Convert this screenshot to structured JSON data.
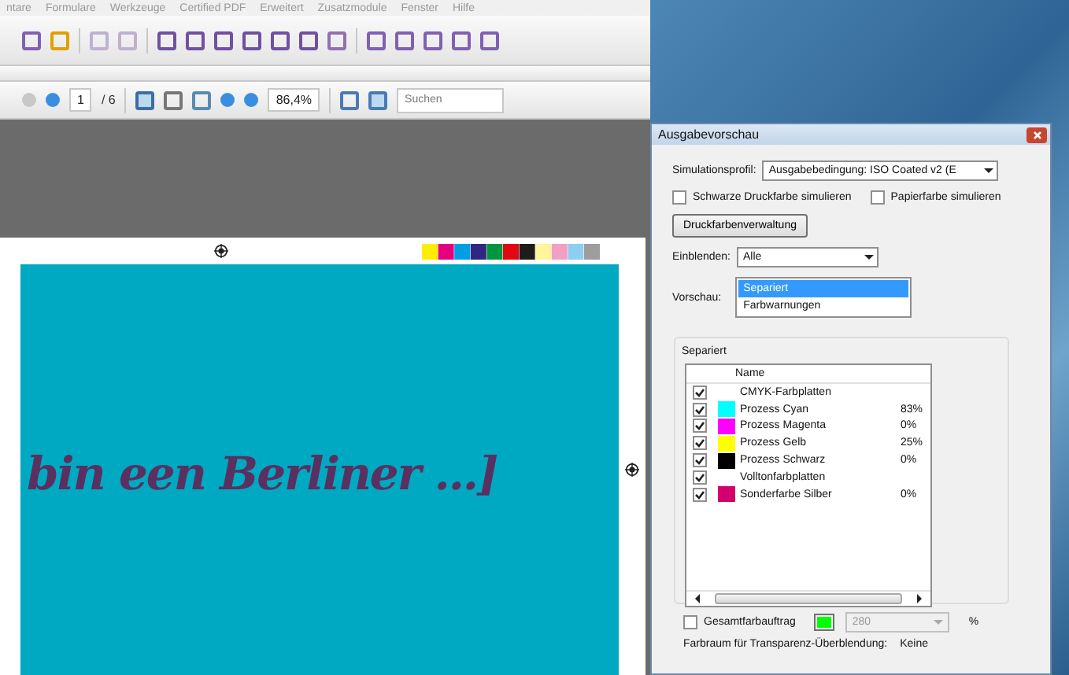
{
  "menu": [
    "ntare",
    "Formulare",
    "Werkzeuge",
    "Certified PDF",
    "Erweitert",
    "Zusatzmodule",
    "Fenster",
    "Hilfe"
  ],
  "navigation": {
    "page": "1",
    "page_count": "/ 6",
    "zoom": "86,4%",
    "search": {
      "placeholder": "Suchen"
    }
  },
  "document": {
    "headline": "bin een Berliner ...]"
  },
  "dialog": {
    "title": "Ausgabevorschau",
    "profile": {
      "label": "Simulationsprofil:",
      "value": "Ausgabebedingung: ISO Coated v2 (E"
    },
    "options": [
      {
        "label": "Schwarze Druckfarbe simulieren",
        "checked": false
      },
      {
        "label": "Papierfarbe simulieren",
        "checked": false
      }
    ],
    "ink_button": "Druckfarbenverwaltung",
    "show": {
      "label": "Einblenden:",
      "value": "Alle"
    },
    "preview": {
      "label": "Vorschau:",
      "items": [
        {
          "label": "Separiert",
          "selected": true
        },
        {
          "label": "Farbwarnungen",
          "selected": false
        }
      ]
    },
    "group_title": "Separiert",
    "column_name": "Name",
    "plates": [
      {
        "kind": "group",
        "name": "CMYK-Farbplatten",
        "checked": true
      },
      {
        "kind": "plate",
        "name": "Prozess Cyan",
        "checked": true,
        "color": "#00ffff",
        "value": "83%"
      },
      {
        "kind": "plate",
        "name": "Prozess Magenta",
        "checked": true,
        "color": "#ff00ff",
        "value": "0%"
      },
      {
        "kind": "plate",
        "name": "Prozess Gelb",
        "checked": true,
        "color": "#ffff00",
        "value": "25%"
      },
      {
        "kind": "plate",
        "name": "Prozess Schwarz",
        "checked": true,
        "color": "#000000",
        "value": "0%"
      },
      {
        "kind": "group",
        "name": "Volltonfarbplatten",
        "checked": true
      },
      {
        "kind": "plate",
        "name": "Sonderfarbe Silber",
        "checked": true,
        "color": "#d4006e",
        "value": "0%"
      }
    ],
    "total_ink": {
      "label": "Gesamtfarbauftrag",
      "checked": false,
      "color": "#00ff00",
      "value": "280",
      "disabled": true,
      "unit": "%"
    },
    "blend_space": {
      "label": "Farbraum für Transparenz-Überblendung:",
      "value": "Keine"
    }
  }
}
